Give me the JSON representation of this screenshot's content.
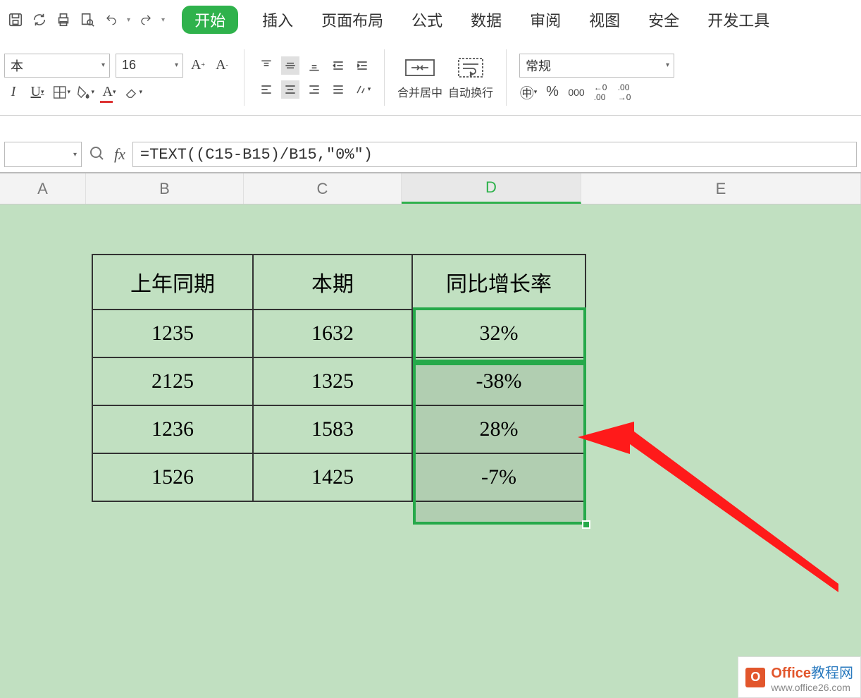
{
  "quick_access": [
    "save",
    "sync",
    "print",
    "preview",
    "undo",
    "redo"
  ],
  "tabs": {
    "items": [
      "开始",
      "插入",
      "页面布局",
      "公式",
      "数据",
      "审阅",
      "视图",
      "安全",
      "开发工具"
    ],
    "active": "开始"
  },
  "font": {
    "name_label": "本",
    "size": "16"
  },
  "ribbon": {
    "merge_label": "合并居中",
    "wrap_label": "自动换行",
    "number_format": "常规"
  },
  "namebox": "",
  "formula": "=TEXT((C15-B15)/B15,\"0%\")",
  "columns": [
    "A",
    "B",
    "C",
    "D",
    "E"
  ],
  "table": {
    "headers": [
      "上年同期",
      "本期",
      "同比增长率"
    ],
    "rows": [
      {
        "b": "1235",
        "c": "1632",
        "d": "32%"
      },
      {
        "b": "2125",
        "c": "1325",
        "d": "-38%"
      },
      {
        "b": "1236",
        "c": "1583",
        "d": "28%"
      },
      {
        "b": "1526",
        "c": "1425",
        "d": "-7%"
      }
    ]
  },
  "watermark": {
    "brand": "Office",
    "brand2": "教程网",
    "url": "www.office26.com"
  },
  "chart_data": {
    "type": "table",
    "headers": [
      "上年同期",
      "本期",
      "同比增长率"
    ],
    "rows": [
      [
        1235,
        1632,
        "32%"
      ],
      [
        2125,
        1325,
        "-38%"
      ],
      [
        1236,
        1583,
        "28%"
      ],
      [
        1526,
        1425,
        "-7%"
      ]
    ]
  }
}
